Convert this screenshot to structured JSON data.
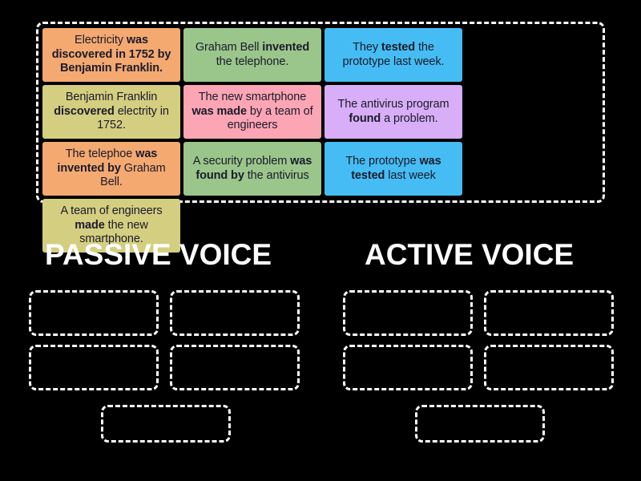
{
  "activity": {
    "type": "group-sort",
    "background_color": "#000000"
  },
  "tile_bank": {
    "name": "tile-bank",
    "border_color": "#ffffff",
    "tiles": [
      {
        "id": "tile-1",
        "color": "#f4a971",
        "text_plain": "Electricity was discovered in 1752 by Benjamin Franklin.",
        "text_html": "Electricity <b>was discovered in 1752 by Benjamin Franklin.</b>"
      },
      {
        "id": "tile-2",
        "color": "#9bc68b",
        "text_plain": "Graham Bell invented the telephone.",
        "text_html": "Graham Bell <b>invented</b> the telephone."
      },
      {
        "id": "tile-3",
        "color": "#45bdf4",
        "text_plain": "They tested the prototype last week.",
        "text_html": "They <b>tested</b> the prototype last week."
      },
      {
        "id": "tile-4",
        "color": "#d4ce80",
        "text_plain": "Benjamin Franklin discovered electrity in 1752.",
        "text_html": "Benjamin Franklin <b>discovered</b> electrity in 1752."
      },
      {
        "id": "tile-5",
        "color": "#fca5b4",
        "text_plain": "The new smartphone was made by a team of engineers",
        "text_html": "The new smartphone <b>was made</b> by a team of engineers"
      },
      {
        "id": "tile-6",
        "color": "#d7aef7",
        "text_plain": "The antivirus program found a problem.",
        "text_html": "The antivirus program <b>found</b> a problem."
      },
      {
        "id": "tile-7",
        "color": "#f4a971",
        "text_plain": "The telephoe was invented by Graham Bell.",
        "text_html": "The telephoe <b>was invented by</b> Graham Bell."
      },
      {
        "id": "tile-8",
        "color": "#9bc68b",
        "text_plain": "A security problem was found by the antivirus",
        "text_html": "A security problem <b>was found by</b> the antivirus"
      },
      {
        "id": "tile-9",
        "color": "#45bdf4",
        "text_plain": "The prototype was tested last week",
        "text_html": "The prototype <b>was tested</b> last week"
      },
      {
        "id": "tile-10",
        "color": "#d4ce80",
        "text_plain": "A team of engineers made the new smartphone.",
        "text_html": "A team of engineers <b>made</b> the new smartphone."
      }
    ]
  },
  "categories": [
    {
      "id": "passive",
      "heading": "PASSIVE VOICE",
      "heading_color": "#ffffff",
      "dropzone_count": 5
    },
    {
      "id": "active",
      "heading": "ACTIVE VOICE",
      "heading_color": "#ffffff",
      "dropzone_count": 5
    }
  ]
}
